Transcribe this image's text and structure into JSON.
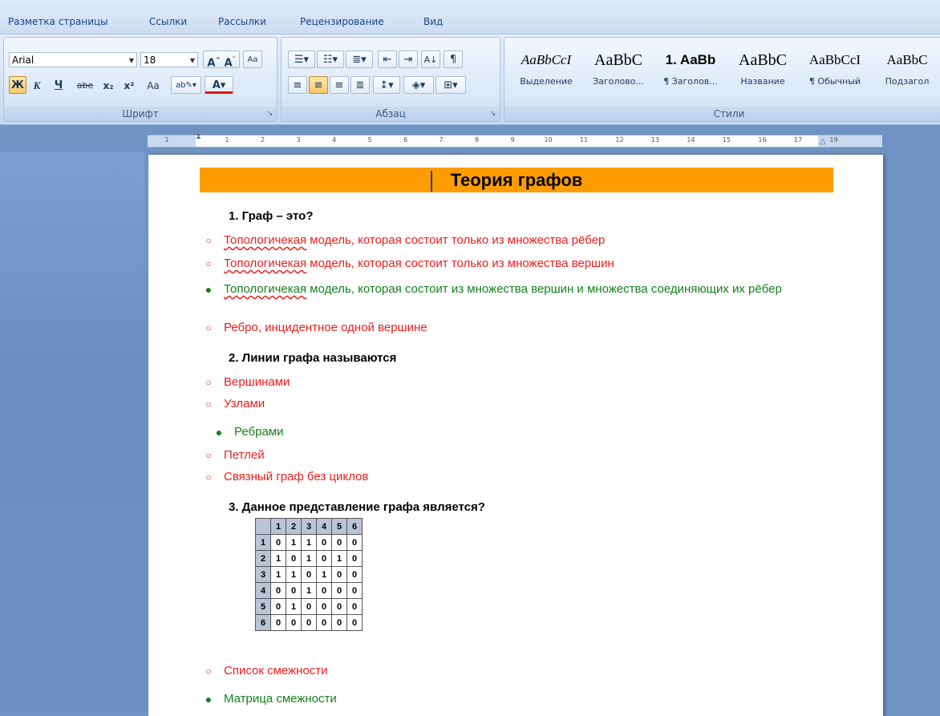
{
  "tabs": [
    "Разметка страницы",
    "Ссылки",
    "Рассылки",
    "Рецензирование",
    "Вид"
  ],
  "font_group": {
    "label": "Шрифт",
    "font_name": "Arial",
    "font_size": "18",
    "buttons": [
      "Ж",
      "К",
      "Ч",
      "abe",
      "x₂",
      "x²",
      "Aa",
      "A"
    ]
  },
  "paragraph_group": {
    "label": "Абзац"
  },
  "styles_group": {
    "label": "Стили",
    "styles": [
      {
        "sample": "AaBbCcI",
        "name": "Выделение"
      },
      {
        "sample": "AaBbC",
        "name": "Заголово..."
      },
      {
        "sample": "1. AaBb",
        "name": "¶ Заголов..."
      },
      {
        "sample": "AaBbC",
        "name": "Название"
      },
      {
        "sample": "AaBbCcI",
        "name": "¶ Обычный"
      },
      {
        "sample": "AaBbC",
        "name": "Подзагол"
      }
    ]
  },
  "ruler": [
    "1",
    "1",
    "2",
    "3",
    "4",
    "5",
    "6",
    "7",
    "8",
    "9",
    "10",
    "11",
    "12",
    "13",
    "14",
    "15",
    "16",
    "17",
    "19"
  ],
  "document": {
    "title": "Теория графов",
    "questions": [
      {
        "label": "1.  Граф – это?",
        "options": [
          {
            "pre": "Топологичекая",
            "text": " модель, которая состоит только из множества рёбер",
            "correct": false
          },
          {
            "pre": "Топологичекая",
            "text": " модель, которая состоит только из множества вершин",
            "correct": false
          },
          {
            "pre": "Топологичекая",
            "text": " модель, которая состоит из множества вершин и множества соединяющих их рёбер",
            "correct": true
          },
          {
            "pre": "",
            "text": "Ребро, инцидентное одной вершине",
            "correct": false
          }
        ]
      },
      {
        "label": "2.  Линии графа называются",
        "options": [
          {
            "pre": "",
            "text": "Вершинами",
            "correct": false
          },
          {
            "pre": "",
            "text": "Узлами",
            "correct": false
          },
          {
            "pre": "",
            "text": "Ребрами",
            "correct": true
          },
          {
            "pre": "",
            "text": "Петлей",
            "correct": false
          },
          {
            "pre": "",
            "text": "Связный граф без циклов",
            "correct": false
          }
        ]
      },
      {
        "label": "3.  Данное представление графа является?",
        "matrix_header": [
          "1",
          "2",
          "3",
          "4",
          "5",
          "6"
        ],
        "matrix": [
          [
            "1",
            "0",
            "1",
            "1",
            "0",
            "0",
            "0"
          ],
          [
            "2",
            "1",
            "0",
            "1",
            "0",
            "1",
            "0"
          ],
          [
            "3",
            "1",
            "1",
            "0",
            "1",
            "0",
            "0"
          ],
          [
            "4",
            "0",
            "0",
            "1",
            "0",
            "0",
            "0"
          ],
          [
            "5",
            "0",
            "1",
            "0",
            "0",
            "0",
            "0"
          ],
          [
            "6",
            "0",
            "0",
            "0",
            "0",
            "0",
            "0"
          ]
        ],
        "options": [
          {
            "pre": "",
            "text": "Список смежности",
            "correct": false
          },
          {
            "pre": "",
            "text": "Матрица смежности",
            "correct": true
          }
        ]
      }
    ]
  },
  "colors": {
    "wrong": "#e8201f",
    "right": "#13821c",
    "title_bg": "#ff9d00"
  }
}
